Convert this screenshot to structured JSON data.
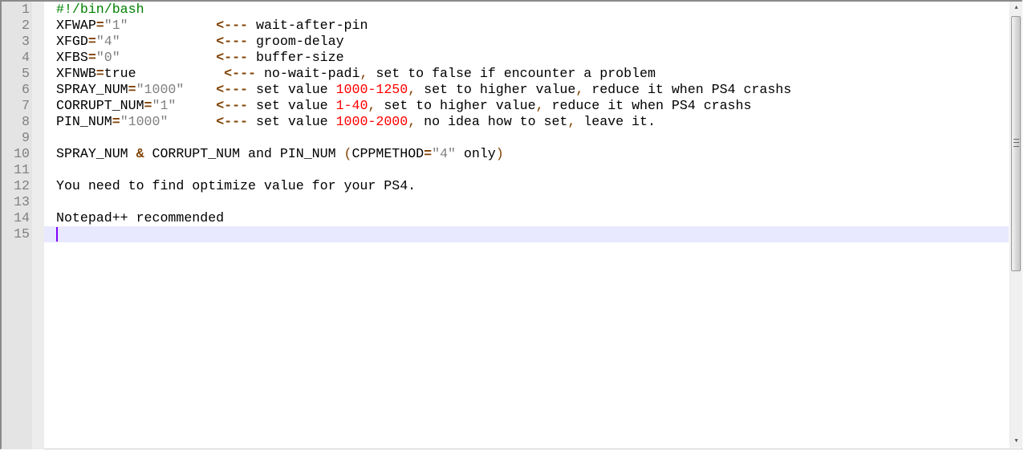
{
  "editor": {
    "current_line": 15,
    "lines": [
      [
        [
          "#!/bin/bash",
          "cmt"
        ]
      ],
      [
        [
          "XFWAP",
          ""
        ],
        [
          "=",
          "op"
        ],
        [
          "\"1\"",
          "str"
        ],
        [
          "           ",
          ""
        ],
        [
          "<---",
          "op"
        ],
        [
          " wait-after-pin",
          ""
        ]
      ],
      [
        [
          "XFGD",
          ""
        ],
        [
          "=",
          "op"
        ],
        [
          "\"4\"",
          "str"
        ],
        [
          "            ",
          ""
        ],
        [
          "<---",
          "op"
        ],
        [
          " groom-delay",
          ""
        ]
      ],
      [
        [
          "XFBS",
          ""
        ],
        [
          "=",
          "op"
        ],
        [
          "\"0\"",
          "str"
        ],
        [
          "            ",
          ""
        ],
        [
          "<---",
          "op"
        ],
        [
          " buffer-size",
          ""
        ]
      ],
      [
        [
          "XFNWB",
          ""
        ],
        [
          "=",
          "op"
        ],
        [
          "true",
          ""
        ],
        [
          "           ",
          ""
        ],
        [
          "<---",
          "op"
        ],
        [
          " no-wait-padi",
          ""
        ],
        [
          ",",
          "pun"
        ],
        [
          " set to false if encounter a problem",
          ""
        ]
      ],
      [
        [
          "SPRAY_NUM",
          ""
        ],
        [
          "=",
          "op"
        ],
        [
          "\"1000\"",
          "str"
        ],
        [
          "    ",
          ""
        ],
        [
          "<---",
          "op"
        ],
        [
          " set value ",
          ""
        ],
        [
          "1000-1250",
          "num"
        ],
        [
          ",",
          "pun"
        ],
        [
          " set to higher value",
          ""
        ],
        [
          ",",
          "pun"
        ],
        [
          " reduce it when PS4 crashs",
          ""
        ]
      ],
      [
        [
          "CORRUPT_NUM",
          ""
        ],
        [
          "=",
          "op"
        ],
        [
          "\"1\"",
          "str"
        ],
        [
          "     ",
          ""
        ],
        [
          "<---",
          "op"
        ],
        [
          " set value ",
          ""
        ],
        [
          "1-40",
          "num"
        ],
        [
          ",",
          "pun"
        ],
        [
          " set to higher value",
          ""
        ],
        [
          ",",
          "pun"
        ],
        [
          " reduce it when PS4 crashs",
          ""
        ]
      ],
      [
        [
          "PIN_NUM",
          ""
        ],
        [
          "=",
          "op"
        ],
        [
          "\"1000\"",
          "str"
        ],
        [
          "      ",
          ""
        ],
        [
          "<---",
          "op"
        ],
        [
          " set value ",
          ""
        ],
        [
          "1000-2000",
          "num"
        ],
        [
          ",",
          "pun"
        ],
        [
          " no idea how to set",
          ""
        ],
        [
          ",",
          "pun"
        ],
        [
          " leave it.",
          ""
        ]
      ],
      [],
      [
        [
          "SPRAY_NUM ",
          ""
        ],
        [
          "&",
          "op"
        ],
        [
          " CORRUPT_NUM and PIN_NUM ",
          ""
        ],
        [
          "(",
          "pun"
        ],
        [
          "CPPMETHOD",
          ""
        ],
        [
          "=",
          "op"
        ],
        [
          "\"4\"",
          "str"
        ],
        [
          " only",
          ""
        ],
        [
          ")",
          "pun"
        ]
      ],
      [],
      [
        [
          "You need to find optimize value for your PS4.",
          ""
        ]
      ],
      [],
      [
        [
          "Notepad++ recommended",
          ""
        ]
      ],
      []
    ]
  },
  "scrollbar": {
    "up_icon": "▲",
    "down_icon": "▼",
    "position": 0.0,
    "visible_fraction": 0.58
  }
}
